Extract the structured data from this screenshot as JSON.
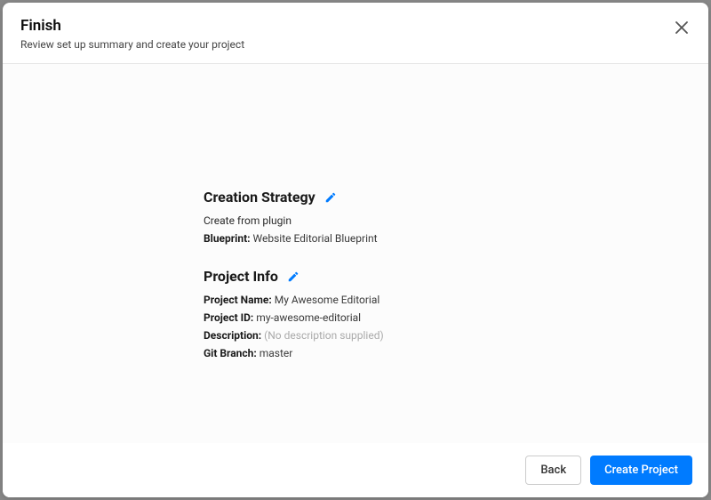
{
  "header": {
    "title": "Finish",
    "subtitle": "Review set up summary and create your project"
  },
  "sections": {
    "creation_strategy": {
      "title": "Creation Strategy",
      "text": "Create from plugin",
      "blueprint_label": "Blueprint:",
      "blueprint_value": "Website Editorial Blueprint"
    },
    "project_info": {
      "title": "Project Info",
      "fields": {
        "project_name_label": "Project Name:",
        "project_name_value": "My Awesome Editorial",
        "project_id_label": "Project ID:",
        "project_id_value": "my-awesome-editorial",
        "description_label": "Description:",
        "description_value": "(No description supplied)",
        "git_branch_label": "Git Branch:",
        "git_branch_value": "master"
      }
    }
  },
  "footer": {
    "back": "Back",
    "create": "Create Project"
  }
}
